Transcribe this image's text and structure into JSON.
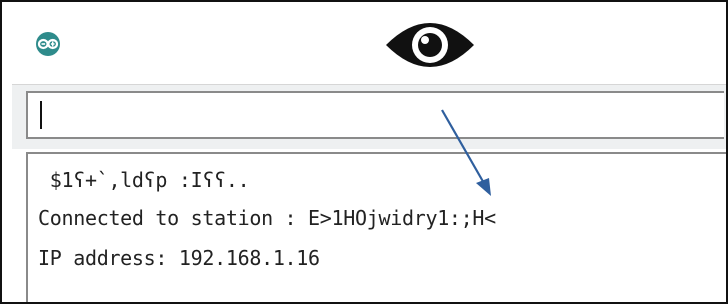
{
  "window": {
    "app_logo": "arduino-logo-icon",
    "overlay_icon": "eye-icon",
    "accent_color": "#2e8b8b"
  },
  "serial_input": {
    "value": ""
  },
  "output": {
    "lines": [
      " $1ʕ+`,ldʕp :Iʕʕ..",
      "Connected to station : E>1HOjwidry1:;H<",
      "IP address: 192.168.1.16"
    ]
  },
  "annotation": {
    "arrow_color": "#2f5f9e"
  }
}
